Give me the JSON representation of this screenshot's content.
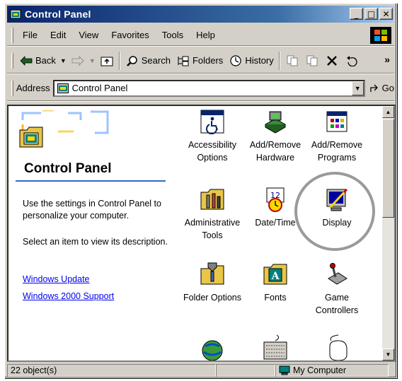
{
  "window": {
    "title": "Control Panel"
  },
  "title_buttons": {
    "minimize": "_",
    "maximize": "□",
    "close": "✕"
  },
  "menu": [
    "File",
    "Edit",
    "View",
    "Favorites",
    "Tools",
    "Help"
  ],
  "toolbar": {
    "back": "Back",
    "search": "Search",
    "folders": "Folders",
    "history": "History",
    "overflow": "»"
  },
  "address": {
    "label": "Address",
    "value": "Control Panel",
    "go": "Go"
  },
  "left_pane": {
    "title": "Control Panel",
    "description": "Use the settings in Control Panel to personalize your computer.",
    "hint": "Select an item to view its description.",
    "links": [
      "Windows Update",
      "Windows 2000 Support"
    ]
  },
  "items": [
    {
      "label": "Accessibility Options",
      "icon": "accessibility-icon"
    },
    {
      "label": "Add/Remove Hardware",
      "icon": "hardware-icon"
    },
    {
      "label": "Add/Remove Programs",
      "icon": "programs-icon"
    },
    {
      "label": "Administrative Tools",
      "icon": "admin-tools-icon"
    },
    {
      "label": "Date/Time",
      "icon": "calendar-clock-icon"
    },
    {
      "label": "Display",
      "icon": "display-icon"
    },
    {
      "label": "Folder Options",
      "icon": "folder-options-icon"
    },
    {
      "label": "Fonts",
      "icon": "fonts-icon"
    },
    {
      "label": "Game Controllers",
      "icon": "joystick-icon"
    }
  ],
  "status": {
    "count": "22 object(s)",
    "zone": "My Computer"
  },
  "colors": {
    "titlebar_start": "#0a246a",
    "titlebar_end": "#a6caf0",
    "link": "#0000ee",
    "rule": "#316ac5",
    "highlight_circle": "#9a9a9a"
  }
}
